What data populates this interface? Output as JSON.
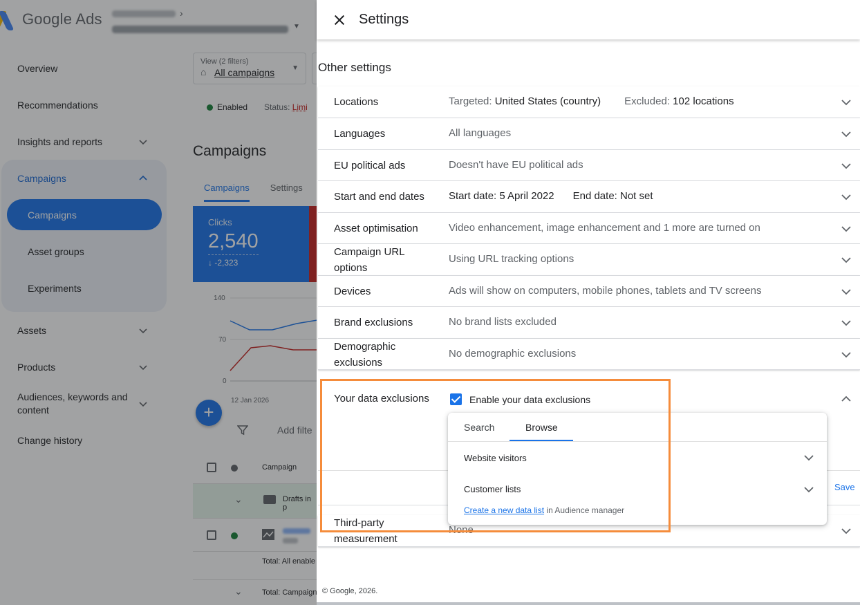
{
  "app": {
    "logo_text": "Google Ads"
  },
  "nav": {
    "items": [
      {
        "label": "Overview"
      },
      {
        "label": "Recommendations"
      },
      {
        "label": "Insights and reports"
      },
      {
        "label": "Campaigns"
      },
      {
        "label": "Assets"
      },
      {
        "label": "Products"
      },
      {
        "label": "Audiences, keywords and content"
      },
      {
        "label": "Change history"
      }
    ],
    "sub_items": [
      {
        "label": "Campaigns"
      },
      {
        "label": "Asset groups"
      },
      {
        "label": "Experiments"
      }
    ]
  },
  "main": {
    "view_label": "View (2 filters)",
    "view_value": "All campaigns",
    "status_enabled": "Enabled",
    "status_label": "Status:",
    "status_value": "Limi",
    "page_title": "Campaigns",
    "tabs": [
      {
        "label": "Campaigns"
      },
      {
        "label": "Settings"
      }
    ],
    "card": {
      "metric": "Clicks",
      "value": "2,540",
      "delta": "↓ -2,323"
    },
    "chart_ticks": [
      "140",
      "70",
      "0"
    ],
    "chart_date": "12 Jan 2026",
    "add_filter": "Add filte",
    "table": {
      "header_campaign": "Campaign",
      "drafts": "Drafts in p",
      "total_enabled": "Total: All enable",
      "total_campaign": "Total: Campaign"
    }
  },
  "panel": {
    "title": "Settings",
    "section_heading": "Other settings",
    "rows": [
      {
        "label": "Locations",
        "targeted_label": "Targeted:",
        "targeted_value": "United States (country)",
        "excluded_label": "Excluded:",
        "excluded_value": "102 locations"
      },
      {
        "label": "Languages",
        "value": "All languages"
      },
      {
        "label": "EU political ads",
        "value": "Doesn't have EU political ads"
      },
      {
        "label": "Start and end dates",
        "start": "Start date: 5 April 2022",
        "end": "End date: Not set"
      },
      {
        "label": "Asset optimisation",
        "value": "Video enhancement, image enhancement and 1 more are turned on"
      },
      {
        "label": "Campaign URL options",
        "value": "Using URL tracking options"
      },
      {
        "label": "Devices",
        "value": "Ads will show on computers, mobile phones, tablets and TV screens"
      },
      {
        "label": "Brand exclusions",
        "value": "No brand lists excluded"
      },
      {
        "label": "Demographic exclusions",
        "value": "No demographic exclusions"
      }
    ],
    "data_exclusions": {
      "label": "Your data exclusions",
      "checkbox_label": "Enable your data exclusions",
      "checked": true,
      "save_label": "Save",
      "popup": {
        "tabs": [
          {
            "label": "Search"
          },
          {
            "label": "Browse"
          }
        ],
        "active_tab": "Browse",
        "items": [
          {
            "label": "Website visitors"
          },
          {
            "label": "Customer lists"
          }
        ],
        "link_text": "Create a new data list",
        "link_suffix": " in Audience manager"
      }
    },
    "third_party": {
      "label": "Third-party measurement",
      "value": "None"
    },
    "footer": "© Google, 2026."
  },
  "colors": {
    "accent": "#1a73e8",
    "highlight_box": "#f58c3b"
  }
}
